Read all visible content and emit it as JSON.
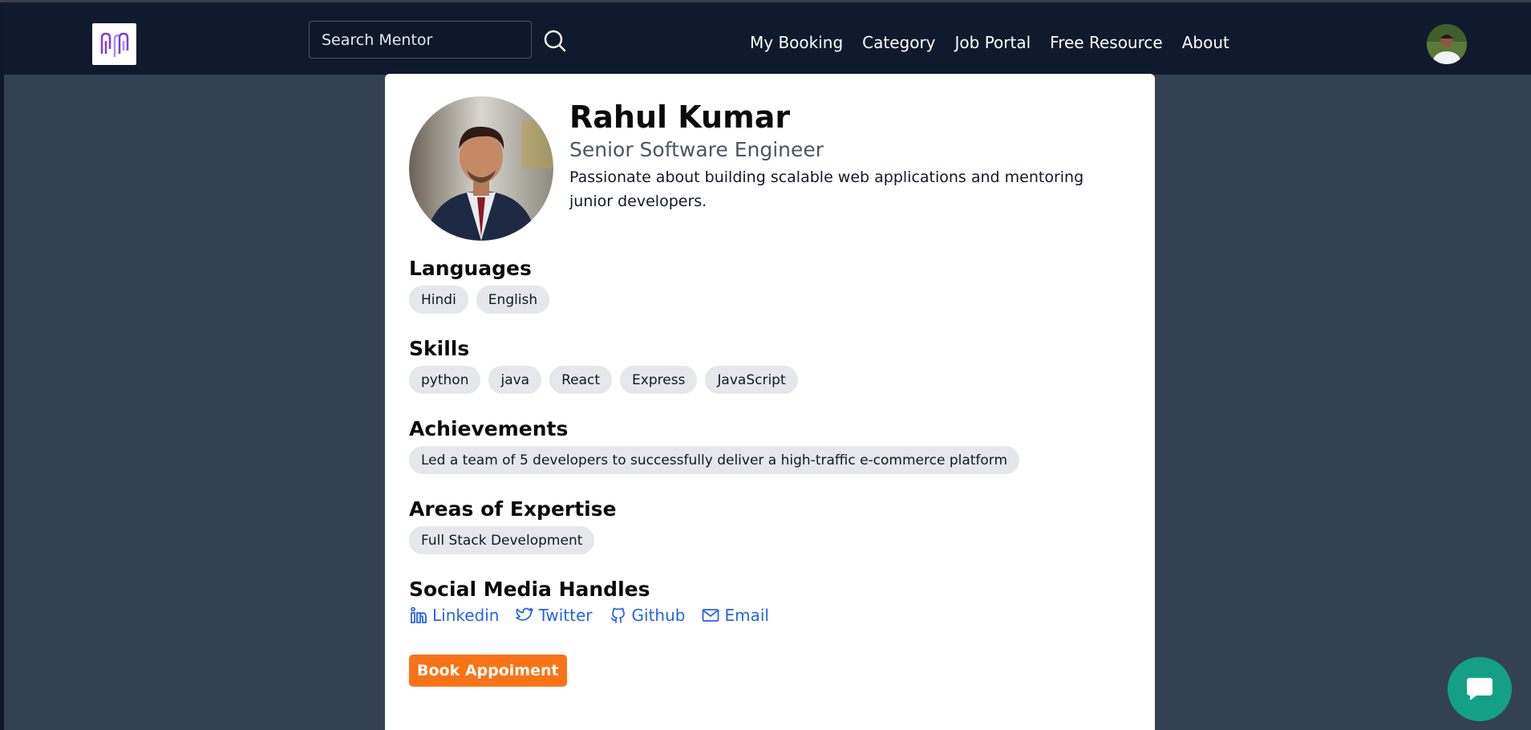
{
  "navbar": {
    "logo_icon": "mentor-logo-icon",
    "search": {
      "placeholder": "Search Mentor",
      "value": ""
    },
    "links": [
      "My Booking",
      "Category",
      "Job Portal",
      "Free Resource",
      "About"
    ]
  },
  "profile": {
    "name": "Rahul Kumar",
    "title": "Senior Software Engineer",
    "bio": "Passionate about building scalable web applications and mentoring junior developers."
  },
  "sections": {
    "languages": {
      "title": "Languages",
      "items": [
        "Hindi",
        "English"
      ]
    },
    "skills": {
      "title": "Skills",
      "items": [
        "python",
        "java",
        "React",
        "Express",
        "JavaScript"
      ]
    },
    "achievements": {
      "title": "Achievements",
      "items": [
        "Led a team of 5 developers to successfully deliver a high-traffic e-commerce platform"
      ]
    },
    "expertise": {
      "title": "Areas of Expertise",
      "items": [
        "Full Stack Development"
      ]
    },
    "social": {
      "title": "Social Media Handles",
      "links": [
        {
          "label": "Linkedin",
          "icon": "linkedin-icon"
        },
        {
          "label": "Twitter",
          "icon": "twitter-icon"
        },
        {
          "label": "Github",
          "icon": "github-icon"
        },
        {
          "label": "Email",
          "icon": "mail-icon"
        }
      ]
    }
  },
  "actions": {
    "book_label": "Book Appoiment"
  },
  "colors": {
    "navbar": "#101a2e",
    "page_bg": "#334155",
    "accent_orange": "#f97316",
    "link_blue": "#2563eb",
    "chat_teal": "#14a086"
  }
}
